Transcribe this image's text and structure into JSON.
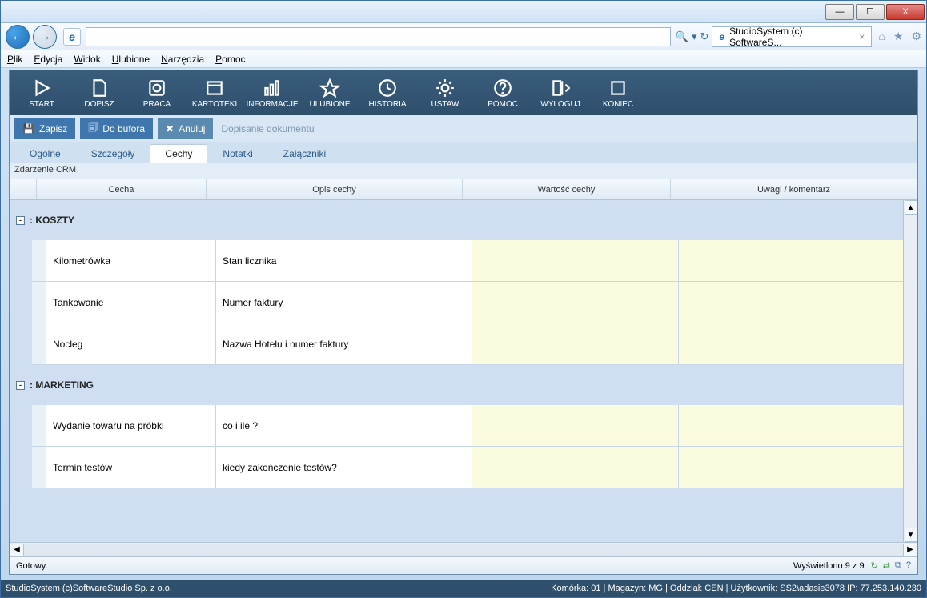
{
  "window": {
    "min": "—",
    "max": "☐",
    "close": "X"
  },
  "browser": {
    "tab_title": "StudioSystem (c) SoftwareS...",
    "tab_close": "×",
    "search_glyph": "🔍",
    "refresh_glyph": "↻",
    "home_glyph": "⌂",
    "star_glyph": "★",
    "gear_glyph": "⚙"
  },
  "menu": {
    "items": [
      "Plik",
      "Edycja",
      "Widok",
      "Ulubione",
      "Narzędzia",
      "Pomoc"
    ]
  },
  "ribbon": {
    "items": [
      {
        "label": "START",
        "icon": "play"
      },
      {
        "label": "DOPISZ",
        "icon": "doc"
      },
      {
        "label": "PRACA",
        "icon": "dash"
      },
      {
        "label": "KARTOTEKI",
        "icon": "window"
      },
      {
        "label": "INFORMACJE",
        "icon": "chart"
      },
      {
        "label": "ULUBIONE",
        "icon": "star"
      },
      {
        "label": "HISTORIA",
        "icon": "history"
      },
      {
        "label": "USTAW",
        "icon": "gear"
      },
      {
        "label": "POMOC",
        "icon": "help"
      },
      {
        "label": "WYLOGUJ",
        "icon": "logout"
      },
      {
        "label": "KONIEC",
        "icon": "stop"
      }
    ]
  },
  "subtoolbar": {
    "save": "Zapisz",
    "buffer": "Do bufora",
    "cancel": "Anuluj",
    "caption": "Dopisanie dokumentu"
  },
  "tabs": {
    "items": [
      "Ogólne",
      "Szczegóły",
      "Cechy",
      "Notatki",
      "Załączniki"
    ],
    "active_index": 2
  },
  "subtitle": "Zdarzenie CRM",
  "columns": {
    "c1": "Cecha",
    "c2": "Opis cechy",
    "c3": "Wartość cechy",
    "c4": "Uwagi / komentarz"
  },
  "groups": [
    {
      "title": ": KOSZTY",
      "rows": [
        {
          "cecha": "Kilometrówka",
          "opis": "Stan licznika",
          "wartosc": "",
          "uwagi": ""
        },
        {
          "cecha": "Tankowanie",
          "opis": "Numer faktury",
          "wartosc": "",
          "uwagi": ""
        },
        {
          "cecha": "Nocleg",
          "opis": "Nazwa Hotelu i numer faktury",
          "wartosc": "",
          "uwagi": ""
        }
      ]
    },
    {
      "title": ": MARKETING",
      "rows": [
        {
          "cecha": "Wydanie towaru na próbki",
          "opis": "co i ile ?",
          "wartosc": "",
          "uwagi": ""
        },
        {
          "cecha": "Termin testów",
          "opis": "kiedy zakończenie testów?",
          "wartosc": "",
          "uwagi": ""
        }
      ]
    }
  ],
  "statusbar": {
    "left": "Gotowy.",
    "right": "Wyświetlono 9 z 9"
  },
  "footer": {
    "left": "StudioSystem (c)SoftwareStudio Sp. z o.o.",
    "right": "Komórka: 01 | Magazyn: MG | Oddział: CEN | Użytkownik: SS2\\adasie3078 IP: 77.253.140.230"
  }
}
